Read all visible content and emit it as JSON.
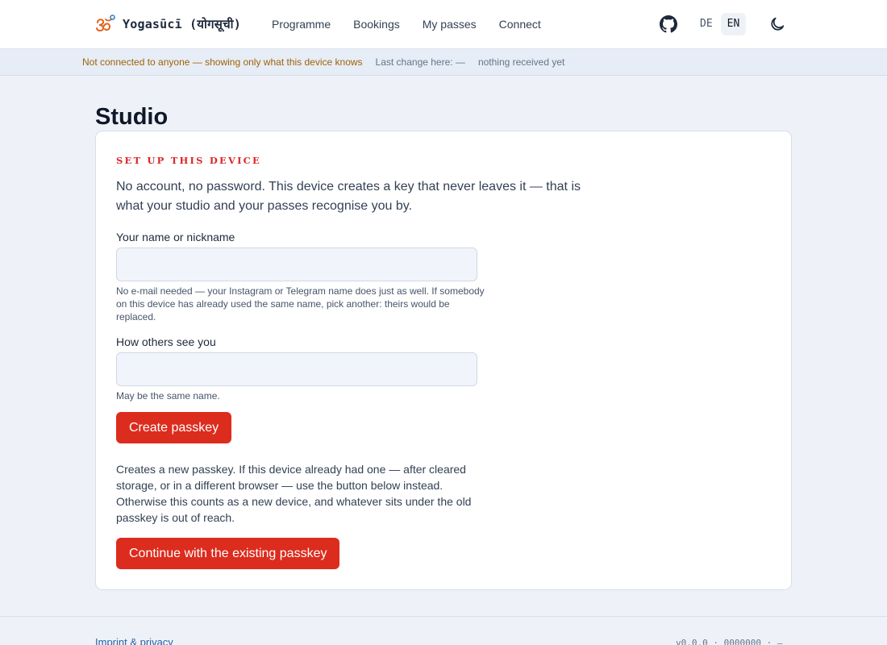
{
  "app": {
    "brand": "Yogasūcī (योगसूची)",
    "logo_icon": "om-icon"
  },
  "nav": {
    "items": [
      {
        "label": "Programme"
      },
      {
        "label": "Bookings"
      },
      {
        "label": "My passes"
      },
      {
        "label": "Connect"
      }
    ]
  },
  "header_actions": {
    "github_icon": "github-icon",
    "languages": [
      {
        "label": "DE",
        "active": false
      },
      {
        "label": "EN",
        "active": true
      }
    ],
    "theme_icon": "moon-icon"
  },
  "status": {
    "connection": "Not connected to anyone — showing only what this device knows",
    "last_change": "Last change here: —",
    "received": "nothing received yet"
  },
  "page": {
    "title": "Studio"
  },
  "setup": {
    "eyebrow": "SET UP THIS DEVICE",
    "intro": "No account, no password. This device creates a key that never leaves it — that is what your studio and your passes recognise you by.",
    "name_label": "Your name or nickname",
    "name_value": "",
    "name_hint": "No e-mail needed — your Instagram or Telegram name does just as well. If somebody on this device has already used the same name, pick another: theirs would be replaced.",
    "display_label": "How others see you",
    "display_value": "",
    "display_hint": "May be the same name.",
    "create_button": "Create passkey",
    "note": "Creates a new passkey. If this device already had one — after cleared storage, or in a different browser — use the button below instead. Otherwise this counts as a new device, and whatever sits under the old passkey is out of reach.",
    "existing_button": "Continue with the existing passkey"
  },
  "footer": {
    "link": "Imprint & privacy",
    "version": "v0.0.0 · 0000000 · —"
  },
  "colors": {
    "accent": "#dc2c1e",
    "eyebrow": "#dc2626",
    "warning_text": "#a16207",
    "link": "#2563a8"
  }
}
